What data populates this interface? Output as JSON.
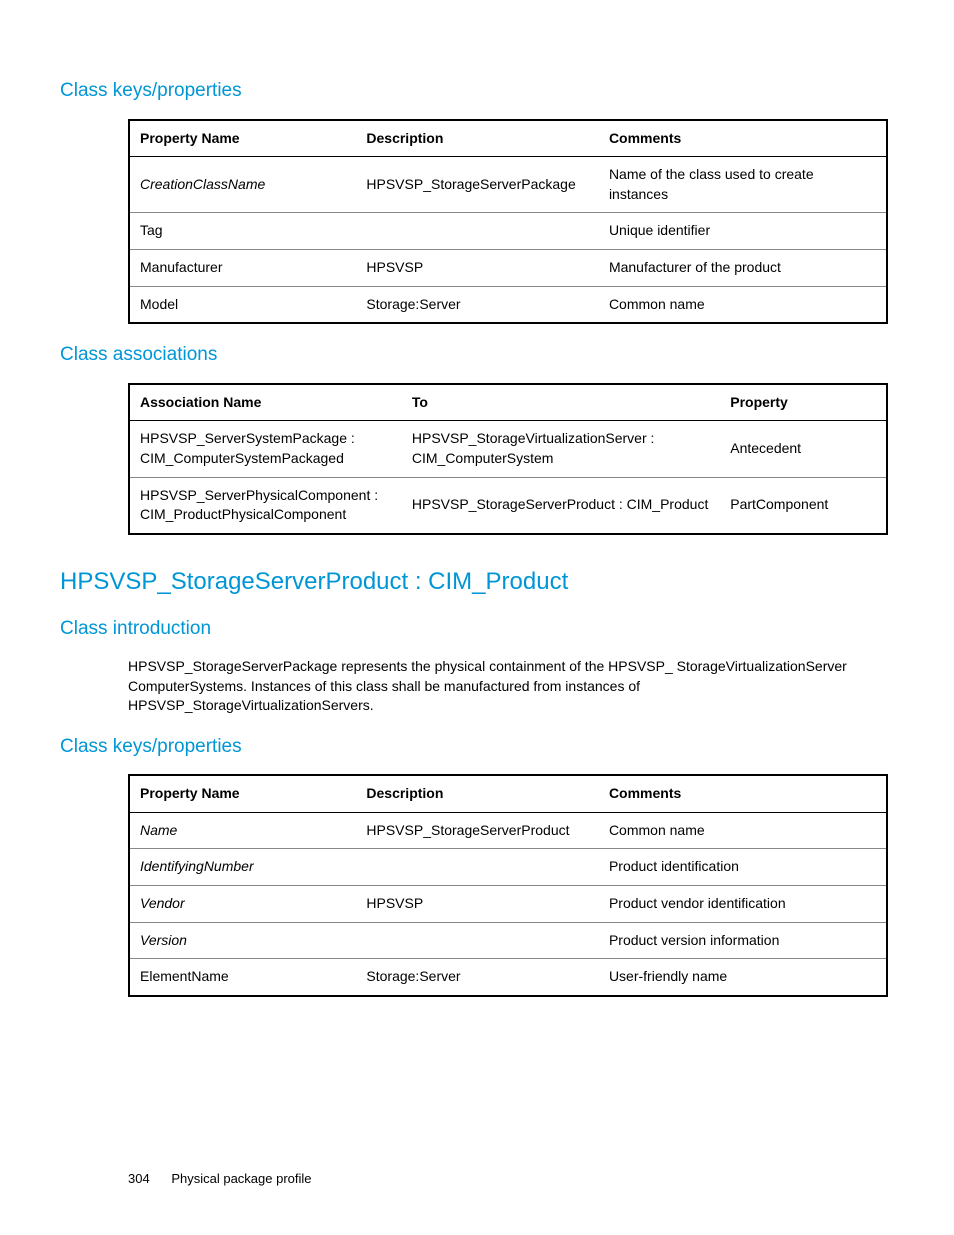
{
  "sections": {
    "keys1": {
      "heading": "Class keys/properties",
      "headers": [
        "Property Name",
        "Description",
        "Comments"
      ],
      "rows": [
        {
          "c0": "CreationClassName",
          "c1": "HPSVSP_StorageServerPackage",
          "c2": "Name of the class used to create instances",
          "italic": true
        },
        {
          "c0": "Tag",
          "c1": "",
          "c2": "Unique identifier",
          "italic": false
        },
        {
          "c0": "Manufacturer",
          "c1": "HPSVSP",
          "c2": "Manufacturer of the product",
          "italic": false
        },
        {
          "c0": "Model",
          "c1": "Storage:Server",
          "c2": "Common name",
          "italic": false
        }
      ]
    },
    "assoc": {
      "heading": "Class associations",
      "headers": [
        "Association Name",
        "To",
        "Property"
      ],
      "rows": [
        {
          "c0": "HPSVSP_ServerSystemPackage : CIM_ComputerSystemPackaged",
          "c1": "HPSVSP_StorageVirtualizationServer : CIM_ComputerSystem",
          "c2": "Antecedent"
        },
        {
          "c0": "HPSVSP_ServerPhysicalComponent : CIM_ProductPhysicalComponent",
          "c1": "HPSVSP_StorageServerProduct : CIM_Product",
          "c2": "PartComponent"
        }
      ]
    },
    "title": "HPSVSP_StorageServerProduct : CIM_Product",
    "intro": {
      "heading": "Class introduction",
      "text": "HPSVSP_StorageServerPackage represents the physical containment of the HPSVSP_ StorageVirtualizationServer ComputerSystems. Instances of this class shall be manufactured from instances of HPSVSP_StorageVirtualizationServers."
    },
    "keys2": {
      "heading": "Class keys/properties",
      "headers": [
        "Property Name",
        "Description",
        "Comments"
      ],
      "rows": [
        {
          "c0": "Name",
          "c1": "HPSVSP_StorageServerProduct",
          "c2": "Common name",
          "italic": true
        },
        {
          "c0": "IdentifyingNumber",
          "c1": "",
          "c2": "Product identification",
          "italic": true
        },
        {
          "c0": "Vendor",
          "c1": "HPSVSP",
          "c2": "Product vendor identification",
          "italic": true
        },
        {
          "c0": "Version",
          "c1": "",
          "c2": "Product version information",
          "italic": true
        },
        {
          "c0": "ElementName",
          "c1": "Storage:Server",
          "c2": "User-friendly name",
          "italic": false
        }
      ]
    }
  },
  "footer": {
    "page": "304",
    "chapter": "Physical package profile"
  }
}
